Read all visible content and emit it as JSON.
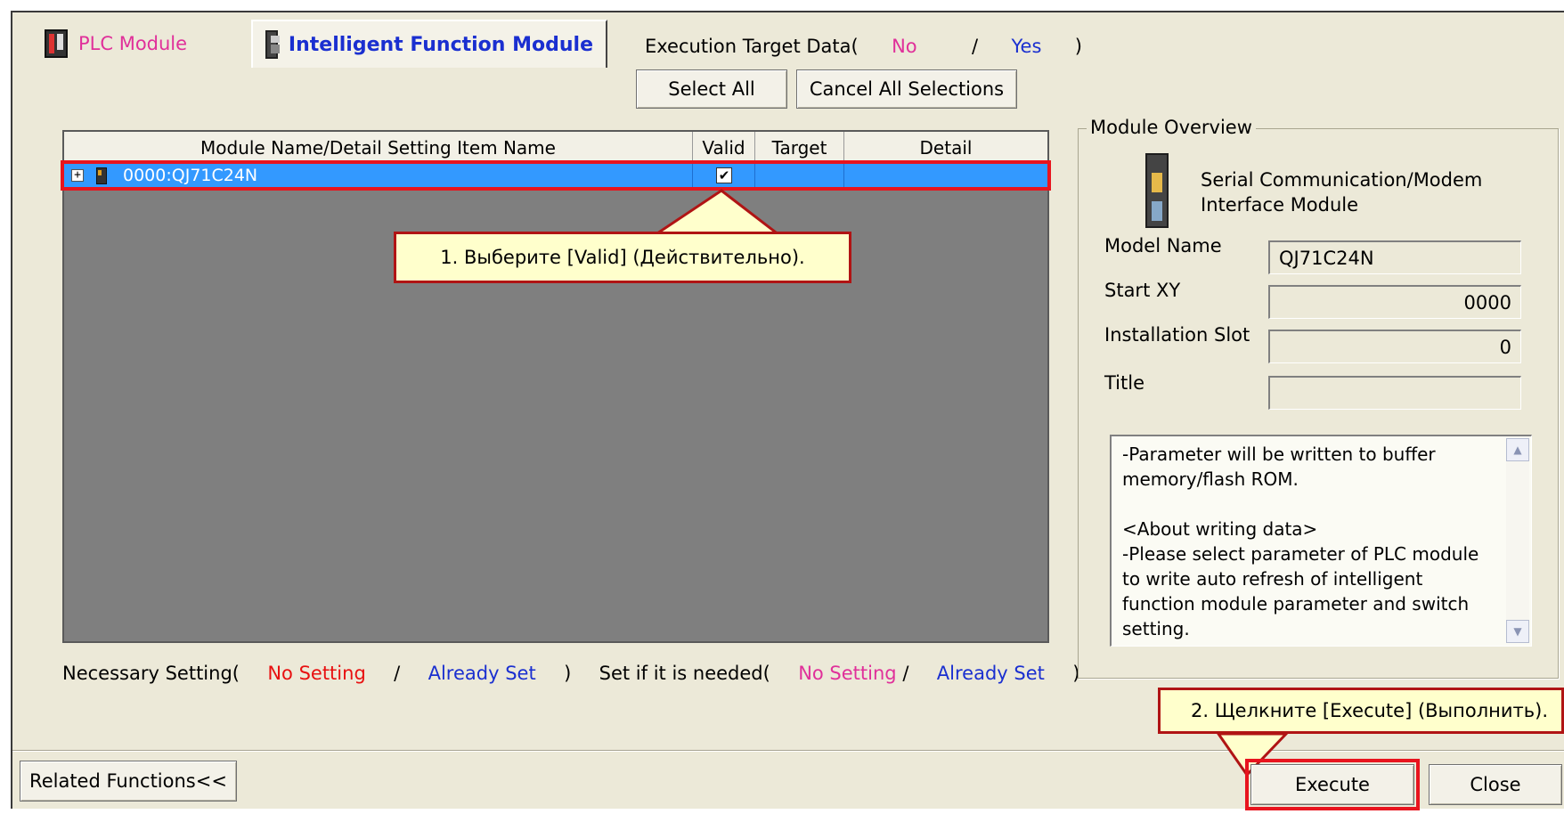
{
  "tabs": {
    "plc_module": "PLC Module",
    "intelligent_function_module": "Intelligent Function Module"
  },
  "execution_target": {
    "label": "Execution Target Data(",
    "no": "No",
    "slash": "/",
    "yes": "Yes",
    "close_paren": ")"
  },
  "buttons": {
    "select_all": "Select All",
    "cancel_all": "Cancel All Selections",
    "related_functions": "Related Functions<<",
    "execute": "Execute",
    "close": "Close"
  },
  "grid": {
    "columns": [
      "Module Name/Detail Setting Item Name",
      "Valid",
      "Target",
      "Detail"
    ],
    "rows": [
      {
        "expand": "+",
        "name": "0000:QJ71C24N",
        "valid": "✔",
        "target": "",
        "detail": ""
      }
    ]
  },
  "status_line": {
    "necessary": "Necessary Setting(",
    "no_setting_1": "No Setting",
    "slash_1": "/",
    "already_set_1": "Already Set",
    "close_1": ")",
    "if_needed": "Set if it is needed(",
    "no_setting_2": "No Setting",
    "slash_2": "/",
    "already_set_2": "Already Set",
    "close_2": ")"
  },
  "overview": {
    "legend": "Module Overview",
    "module_type_line1": "Serial Communication/Modem",
    "module_type_line2": "Interface Module",
    "fields": {
      "model_name": {
        "label": "Model Name",
        "value": "QJ71C24N"
      },
      "start_xy": {
        "label": "Start XY",
        "value": "0000"
      },
      "installation_slot": {
        "label": "Installation Slot",
        "value": "0"
      },
      "title": {
        "label": "Title",
        "value": ""
      }
    },
    "notes": "-Parameter will be written to buffer memory/flash ROM.\n\n<About writing data>\n-Please select parameter of PLC module to write auto refresh of intelligent function module parameter and switch setting."
  },
  "callouts": {
    "step1": "1. Выберите [Valid] (Действительно).",
    "step2": "2. Щелкните [Execute] (Выполнить)."
  },
  "colors": {
    "dialog_bg": "#ece9d8",
    "selection": "#3399ff",
    "grid_bg": "#7f7f7f",
    "highlight": "#e8141e",
    "callout_bg": "#ffffcc",
    "link_blue": "#1a2fd0",
    "pink": "#e0309a",
    "red": "#e81010"
  }
}
